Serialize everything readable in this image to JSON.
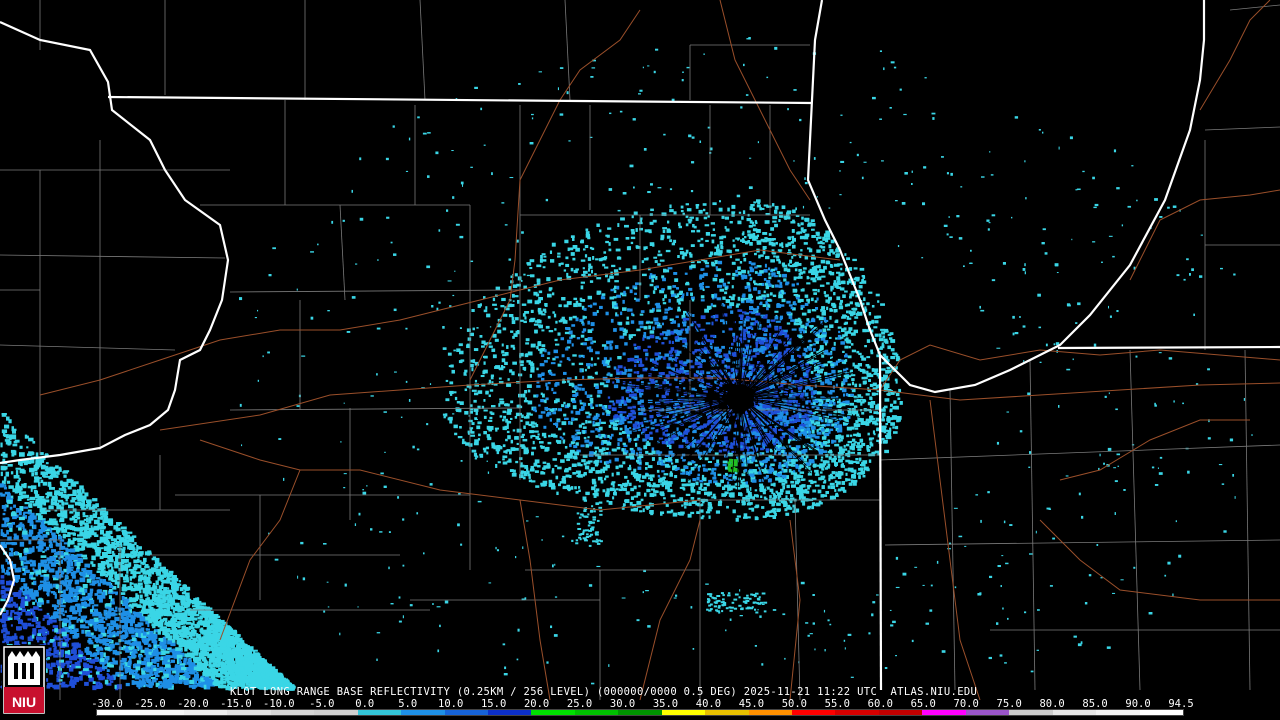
{
  "caption": "KLOT LONG RANGE BASE REFLECTIVITY (0.25KM / 256 LEVEL) (000000/0000 0.5 DEG) 2025-11-21 11:22 UTC  ATLAS.NIU.EDU",
  "logo_text": "NIU",
  "scale": {
    "labels": [
      "-30.0",
      "-25.0",
      "-20.0",
      "-15.0",
      "-10.0",
      "-5.0",
      "0.0",
      "5.0",
      "10.0",
      "15.0",
      "20.0",
      "25.0",
      "30.0",
      "35.0",
      "40.0",
      "45.0",
      "50.0",
      "55.0",
      "60.0",
      "65.0",
      "70.0",
      "75.0",
      "80.0",
      "85.0",
      "90.0",
      "94.5"
    ],
    "colors": [
      "#ffffff",
      "#f6f6f6",
      "#eeeeee",
      "#e2e2e2",
      "#d6d6d6",
      "#cfcfcf",
      "#33c5d8",
      "#1e90e6",
      "#1663d8",
      "#0c2fc8",
      "#00e000",
      "#00c000",
      "#009400",
      "#ffff00",
      "#e7c000",
      "#ff9000",
      "#ff0000",
      "#d60000",
      "#c00000",
      "#ff00ff",
      "#9955c9",
      "#cccccc",
      "#e6e6e6",
      "#f2f2f2",
      "#ffffff"
    ]
  },
  "map": {
    "colors": {
      "background": "#000000",
      "state_lines": "#ffffff",
      "county_lines": "#7a7a7a",
      "roads": "#a0522d",
      "echo_light": "#3ad6e6",
      "echo_mid": "#1e8fe6",
      "echo_dark": "#1f4fd8",
      "echo_green": "#22c022"
    }
  }
}
